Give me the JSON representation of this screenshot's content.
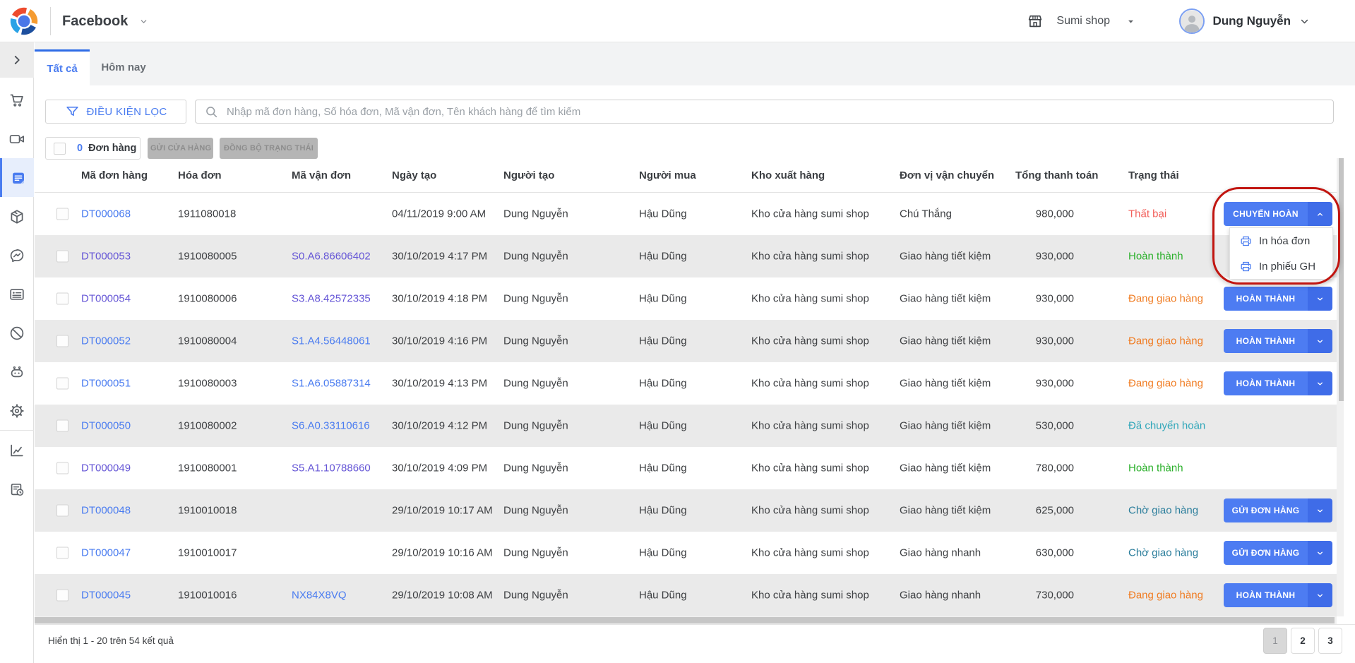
{
  "topbar": {
    "channel": "Facebook",
    "shop": "Sumi shop",
    "user": "Dung Nguyễn",
    "logo_icon": "pinwheel-logo",
    "shop_icon": "storefront",
    "colors": {
      "logo_red": "#ee4c2c",
      "logo_orange": "#f59b30",
      "logo_navy": "#1d4f9e",
      "logo_cyan": "#2aa2e6",
      "logo_center": "#4a77e8"
    }
  },
  "sidebar": {
    "items": [
      {
        "icon": "chevron-right",
        "name": "collapse-toggle"
      },
      {
        "icon": "cart",
        "name": "sales"
      },
      {
        "icon": "video-camera",
        "name": "livestream"
      },
      {
        "icon": "document",
        "name": "orders",
        "active": true
      },
      {
        "icon": "package",
        "name": "products"
      },
      {
        "icon": "messenger-chat",
        "name": "conversations"
      },
      {
        "icon": "card",
        "name": "posts"
      },
      {
        "icon": "block",
        "name": "blocked"
      },
      {
        "icon": "robot",
        "name": "chatbot"
      },
      {
        "icon": "gear",
        "name": "settings"
      },
      {
        "icon": "chart",
        "name": "analytics"
      },
      {
        "icon": "report-clock",
        "name": "history"
      }
    ]
  },
  "tabs": [
    {
      "label": "Tất cả",
      "active": true
    },
    {
      "label": "Hôm nay",
      "active": false
    }
  ],
  "filter": {
    "button_label": "ĐIỀU KIỆN LỌC",
    "search_placeholder": "Nhập mã đơn hàng, Số hóa đơn, Mã vận đơn, Tên khách hàng để tìm kiếm"
  },
  "actions": {
    "selected_count": "0",
    "selected_label": "Đơn hàng",
    "send_store_label": "GỬI CỬA HÀNG",
    "sync_status_label": "ĐỒNG BỘ TRẠNG THÁI"
  },
  "table": {
    "headers": [
      "Mã đơn hàng",
      "Hóa đơn",
      "Mã vận đơn",
      "Ngày tạo",
      "Người tạo",
      "Người mua",
      "Kho xuất hàng",
      "Đơn vị vận chuyển",
      "Tổng thanh toán",
      "Trạng thái"
    ],
    "rows": [
      {
        "code": "DT000068",
        "invoice": "1911080018",
        "tracking": "",
        "created": "04/11/2019 9:00 AM",
        "creator": "Dung Nguyễn",
        "buyer": "Hậu Dũng",
        "warehouse": "Kho cửa hàng sumi shop",
        "carrier": "Chú Thắng",
        "total": "980,000",
        "status": "Thất bại",
        "status_color": "#f25f5a",
        "action": "CHUYỂN HOÀN"
      },
      {
        "code": "DT000053",
        "invoice": "1910080005",
        "tracking": "S0.A6.86606402",
        "created": "30/10/2019 4:17 PM",
        "creator": "Dung Nguyễn",
        "buyer": "Hậu Dũng",
        "warehouse": "Kho cửa hàng sumi shop",
        "carrier": "Giao hàng tiết kiệm",
        "total": "930,000",
        "status": "Hoàn thành",
        "status_color": "#2bb02b",
        "action": ""
      },
      {
        "code": "DT000054",
        "invoice": "1910080006",
        "tracking": "S3.A8.42572335",
        "created": "30/10/2019 4:18 PM",
        "creator": "Dung Nguyễn",
        "buyer": "Hậu Dũng",
        "warehouse": "Kho cửa hàng sumi shop",
        "carrier": "Giao hàng tiết kiệm",
        "total": "930,000",
        "status": "Đang giao hàng",
        "status_color": "#f07c22",
        "action": "HOÀN THÀNH"
      },
      {
        "code": "DT000052",
        "invoice": "1910080004",
        "tracking": "S1.A4.56448061",
        "created": "30/10/2019 4:16 PM",
        "creator": "Dung Nguyễn",
        "buyer": "Hậu Dũng",
        "warehouse": "Kho cửa hàng sumi shop",
        "carrier": "Giao hàng tiết kiệm",
        "total": "930,000",
        "status": "Đang giao hàng",
        "status_color": "#f07c22",
        "action": "HOÀN THÀNH"
      },
      {
        "code": "DT000051",
        "invoice": "1910080003",
        "tracking": "S1.A6.05887314",
        "created": "30/10/2019 4:13 PM",
        "creator": "Dung Nguyễn",
        "buyer": "Hậu Dũng",
        "warehouse": "Kho cửa hàng sumi shop",
        "carrier": "Giao hàng tiết kiệm",
        "total": "930,000",
        "status": "Đang giao hàng",
        "status_color": "#f07c22",
        "action": "HOÀN THÀNH"
      },
      {
        "code": "DT000050",
        "invoice": "1910080002",
        "tracking": "S6.A0.33110616",
        "created": "30/10/2019 4:12 PM",
        "creator": "Dung Nguyễn",
        "buyer": "Hậu Dũng",
        "warehouse": "Kho cửa hàng sumi shop",
        "carrier": "Giao hàng tiết kiệm",
        "total": "530,000",
        "status": "Đã chuyển hoàn",
        "status_color": "#2fa6b9",
        "action": ""
      },
      {
        "code": "DT000049",
        "invoice": "1910080001",
        "tracking": "S5.A1.10788660",
        "created": "30/10/2019 4:09 PM",
        "creator": "Dung Nguyễn",
        "buyer": "Hậu Dũng",
        "warehouse": "Kho cửa hàng sumi shop",
        "carrier": "Giao hàng tiết kiệm",
        "total": "780,000",
        "status": "Hoàn thành",
        "status_color": "#2bb02b",
        "action": ""
      },
      {
        "code": "DT000048",
        "invoice": "1910010018",
        "tracking": "",
        "created": "29/10/2019 10:17 AM",
        "creator": "Dung Nguyễn",
        "buyer": "Hậu Dũng",
        "warehouse": "Kho cửa hàng sumi shop",
        "carrier": "Giao hàng tiết kiệm",
        "total": "625,000",
        "status": "Chờ giao hàng",
        "status_color": "#2a7d9b",
        "action": "GỬI ĐƠN HÀNG"
      },
      {
        "code": "DT000047",
        "invoice": "1910010017",
        "tracking": "",
        "created": "29/10/2019 10:16 AM",
        "creator": "Dung Nguyễn",
        "buyer": "Hậu Dũng",
        "warehouse": "Kho cửa hàng sumi shop",
        "carrier": "Giao hàng nhanh",
        "total": "630,000",
        "status": "Chờ giao hàng",
        "status_color": "#2a7d9b",
        "action": "GỬI ĐƠN HÀNG"
      },
      {
        "code": "DT000045",
        "invoice": "1910010016",
        "tracking": "NX84X8VQ",
        "created": "29/10/2019 10:08 AM",
        "creator": "Dung Nguyễn",
        "buyer": "Hậu Dũng",
        "warehouse": "Kho cửa hàng sumi shop",
        "carrier": "Giao hàng nhanh",
        "total": "730,000",
        "status": "Đang giao hàng",
        "status_color": "#f07c22",
        "action": "HOÀN THÀNH"
      }
    ]
  },
  "dropdown": {
    "open_for_row": "DT000068",
    "button_label": "CHUYỂN HOÀN",
    "items": [
      {
        "icon": "printer",
        "label": "In hóa đơn"
      },
      {
        "icon": "printer",
        "label": "In phiếu GH"
      }
    ]
  },
  "annotation": {
    "shape": "hand-drawn-red-ellipse",
    "color": "#c2130e"
  },
  "footer": {
    "summary": "Hiển thị 1 - 20 trên 54 kết quả",
    "pages": [
      "1",
      "2",
      "3"
    ],
    "active_page": "1"
  },
  "colors": {
    "accent_blue": "#4a7cf0",
    "visited_purple": "#6556d6",
    "status_fail": "#f25f5a",
    "status_done": "#2bb02b",
    "status_shipping": "#f07c22",
    "status_returned": "#2fa6b9",
    "status_waiting": "#2a7d9b",
    "row_stripe": "#eaeaea"
  }
}
